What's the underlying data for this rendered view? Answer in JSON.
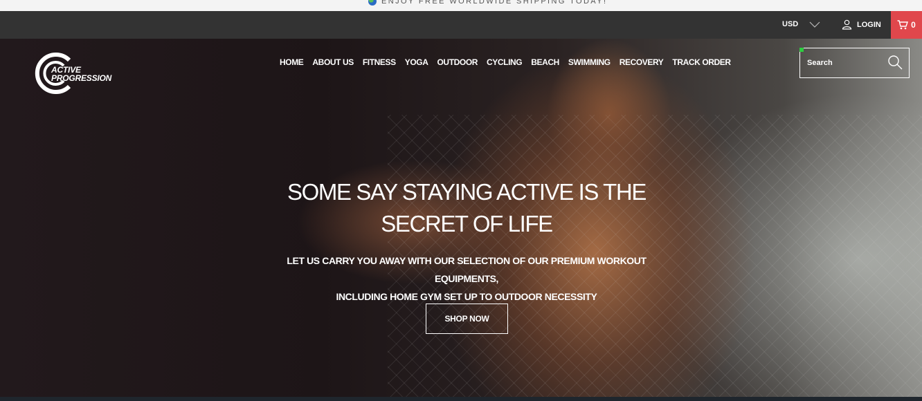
{
  "announcement": {
    "text": "ENJOY FREE WORLDWIDE SHIPPING TODAY!",
    "icon": "globe-icon"
  },
  "topbar": {
    "currency": "USD",
    "login_label": "LOGIN",
    "cart_count": "0",
    "cart_color": "#e0474c"
  },
  "logo": {
    "line1": "ACTIVE",
    "line2": "PROGRESSION"
  },
  "nav": {
    "items": [
      "HOME",
      "ABOUT US",
      "FITNESS",
      "YOGA",
      "OUTDOOR",
      "CYCLING",
      "BEACH",
      "SWIMMING",
      "RECOVERY",
      "TRACK ORDER"
    ]
  },
  "search": {
    "placeholder": "Search"
  },
  "hero": {
    "headline": "SOME SAY STAYING ACTIVE IS THE SECRET OF LIFE",
    "subline_1": "LET US CARRY YOU AWAY WITH OUR SELECTION OF OUR PREMIUM WORKOUT EQUIPMENTS,",
    "subline_2": "INCLUDING HOME GYM SET UP TO OUTDOOR NECESSITY",
    "cta_label": "SHOP NOW"
  }
}
